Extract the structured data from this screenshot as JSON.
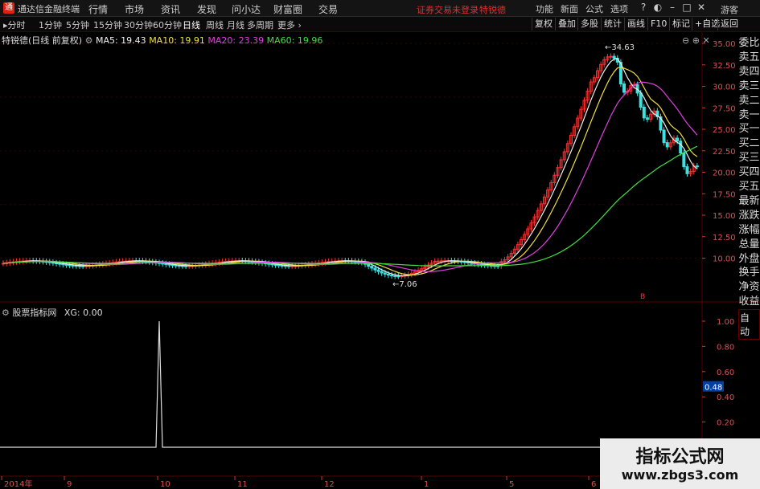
{
  "menubar": {
    "app_title": "通达信金融终端",
    "items": [
      "行情",
      "市场",
      "资讯",
      "发现",
      "问小达",
      "财富圈",
      "交易"
    ],
    "login_notice": "证券交易未登录",
    "login_user": "特锐德",
    "right_items": [
      "功能",
      "新面",
      "公式",
      "选项"
    ],
    "guest": "游客"
  },
  "periodbar": {
    "tabs": [
      "分时",
      "1分钟",
      "5分钟",
      "15分钟",
      "30分钟",
      "60分钟",
      "日线",
      "周线",
      "月线",
      "多周期",
      "更多"
    ],
    "active": "日线",
    "right_buttons": [
      "复权",
      "叠加",
      "多股",
      "统计",
      "画线",
      "F10",
      "标记",
      "+自选",
      "返回"
    ]
  },
  "main_chart": {
    "title": "特锐德(日线 前复权)",
    "ma": [
      {
        "label": "MA5: 19.43",
        "color": "#f0f0f0"
      },
      {
        "label": "MA10: 19.91",
        "color": "#f0e040"
      },
      {
        "label": "MA20: 23.39",
        "color": "#e040e0"
      },
      {
        "label": "MA60: 19.96",
        "color": "#40e040"
      }
    ],
    "price_axis": [
      "35.00",
      "32.50",
      "30.00",
      "27.50",
      "25.00",
      "22.50",
      "20.00",
      "17.50",
      "15.00",
      "12.50",
      "10.00"
    ],
    "high_label": "34.63",
    "low_label": "7.06",
    "marker": "B"
  },
  "sub_chart": {
    "title": "股票指标网",
    "xg": "XG: 0.00",
    "axis": [
      "1.00",
      "0.80",
      "0.60",
      "0.40",
      "0.20"
    ],
    "current": "0.48"
  },
  "time_axis": [
    "2014年",
    "9",
    "10",
    "11",
    "12",
    "1",
    "5",
    "6"
  ],
  "side_list": [
    "委比",
    "卖五",
    "卖四",
    "卖三",
    "卖二",
    "卖一",
    "买一",
    "买二",
    "买三",
    "买四",
    "买五",
    "最新",
    "涨跌",
    "涨幅",
    "总量",
    "外盘",
    "换手",
    "净资",
    "收益"
  ],
  "side_auto": "自动",
  "watermark": {
    "line1": "指标公式网",
    "line2": "www.zbgs3.com"
  },
  "colors": {
    "up": "#ff3030",
    "down": "#40e0e0",
    "ma5": "#f0f0f0",
    "ma10": "#f0e040",
    "ma20": "#e040e0",
    "ma60": "#40e040",
    "grid": "#5a0000"
  }
}
